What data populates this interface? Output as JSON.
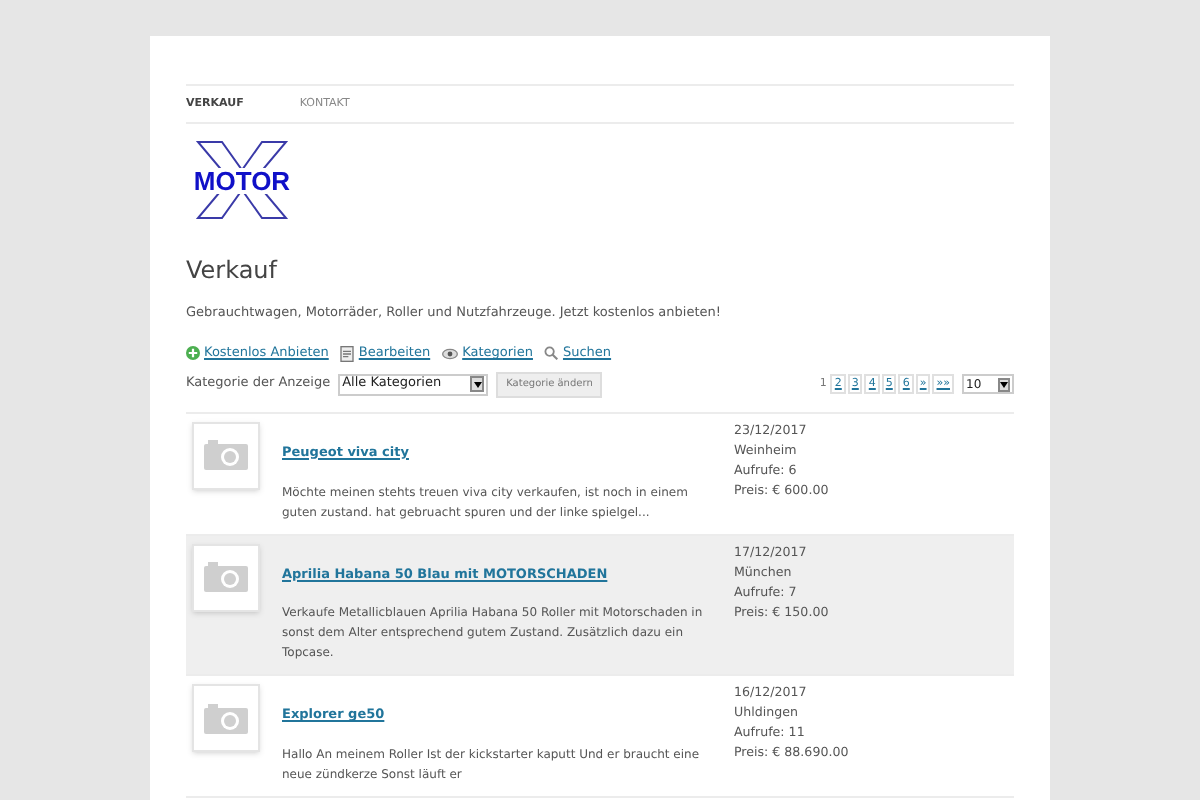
{
  "nav": [
    {
      "label": "VERKAUF",
      "selected": true
    },
    {
      "label": "KONTAKT",
      "selected": false
    }
  ],
  "logo": {
    "text": "MOTOR"
  },
  "heading": "Verkauf",
  "description": "Gebrauchtwagen, Motorräder, Roller und Nutzfahrzeuge. Jetzt kostenlos anbieten!",
  "actions": [
    {
      "label": "Kostenlos Anbieten",
      "kind": "add"
    },
    {
      "label": "Bearbeiten",
      "kind": "edit"
    },
    {
      "label": "Kategorien",
      "kind": "categories"
    },
    {
      "label": "Suchen",
      "kind": "search"
    }
  ],
  "filter": {
    "label": "Kategorie der Anzeige",
    "value": "Alle Kategorien",
    "button": "Kategorie ändern"
  },
  "pagination": {
    "pages": [
      {
        "label": "1",
        "selected": true
      },
      {
        "label": "2",
        "selected": false
      },
      {
        "label": "3",
        "selected": false
      },
      {
        "label": "4",
        "selected": false
      },
      {
        "label": "5",
        "selected": false
      },
      {
        "label": "6",
        "selected": false
      },
      {
        "label": "»",
        "selected": false
      },
      {
        "label": "»»",
        "selected": false
      }
    ],
    "per_page": "10"
  },
  "listings": [
    {
      "title": "Peugeot viva city",
      "text": "Möchte meinen stehts treuen viva city verkaufen, ist noch in einem guten zustand. hat gebruacht spuren und der linke spielgel...",
      "date": "23/12/2017",
      "city": "Weinheim",
      "views": "Aufrufe: 6",
      "price": "Preis: € 600.00",
      "highlighted": false
    },
    {
      "title": "Aprilia Habana 50 Blau mit MOTORSCHADEN",
      "text": "Verkaufe Metallicblauen Aprilia Habana 50 Roller mit Motorschaden in sonst dem Alter entsprechend gutem Zustand. Zusätzlich dazu ein Topcase.",
      "date": "17/12/2017",
      "city": "München",
      "views": "Aufrufe: 7",
      "price": "Preis: € 150.00",
      "highlighted": true
    },
    {
      "title": "Explorer ge50",
      "text": "Hallo An meinem Roller Ist der kickstarter kaputt Und er braucht eine neue zündkerze Sonst läuft er",
      "date": "16/12/2017",
      "city": "Uhldingen",
      "views": "Aufrufe: 11",
      "price": "Preis: € 88.690.00",
      "highlighted": false
    }
  ]
}
